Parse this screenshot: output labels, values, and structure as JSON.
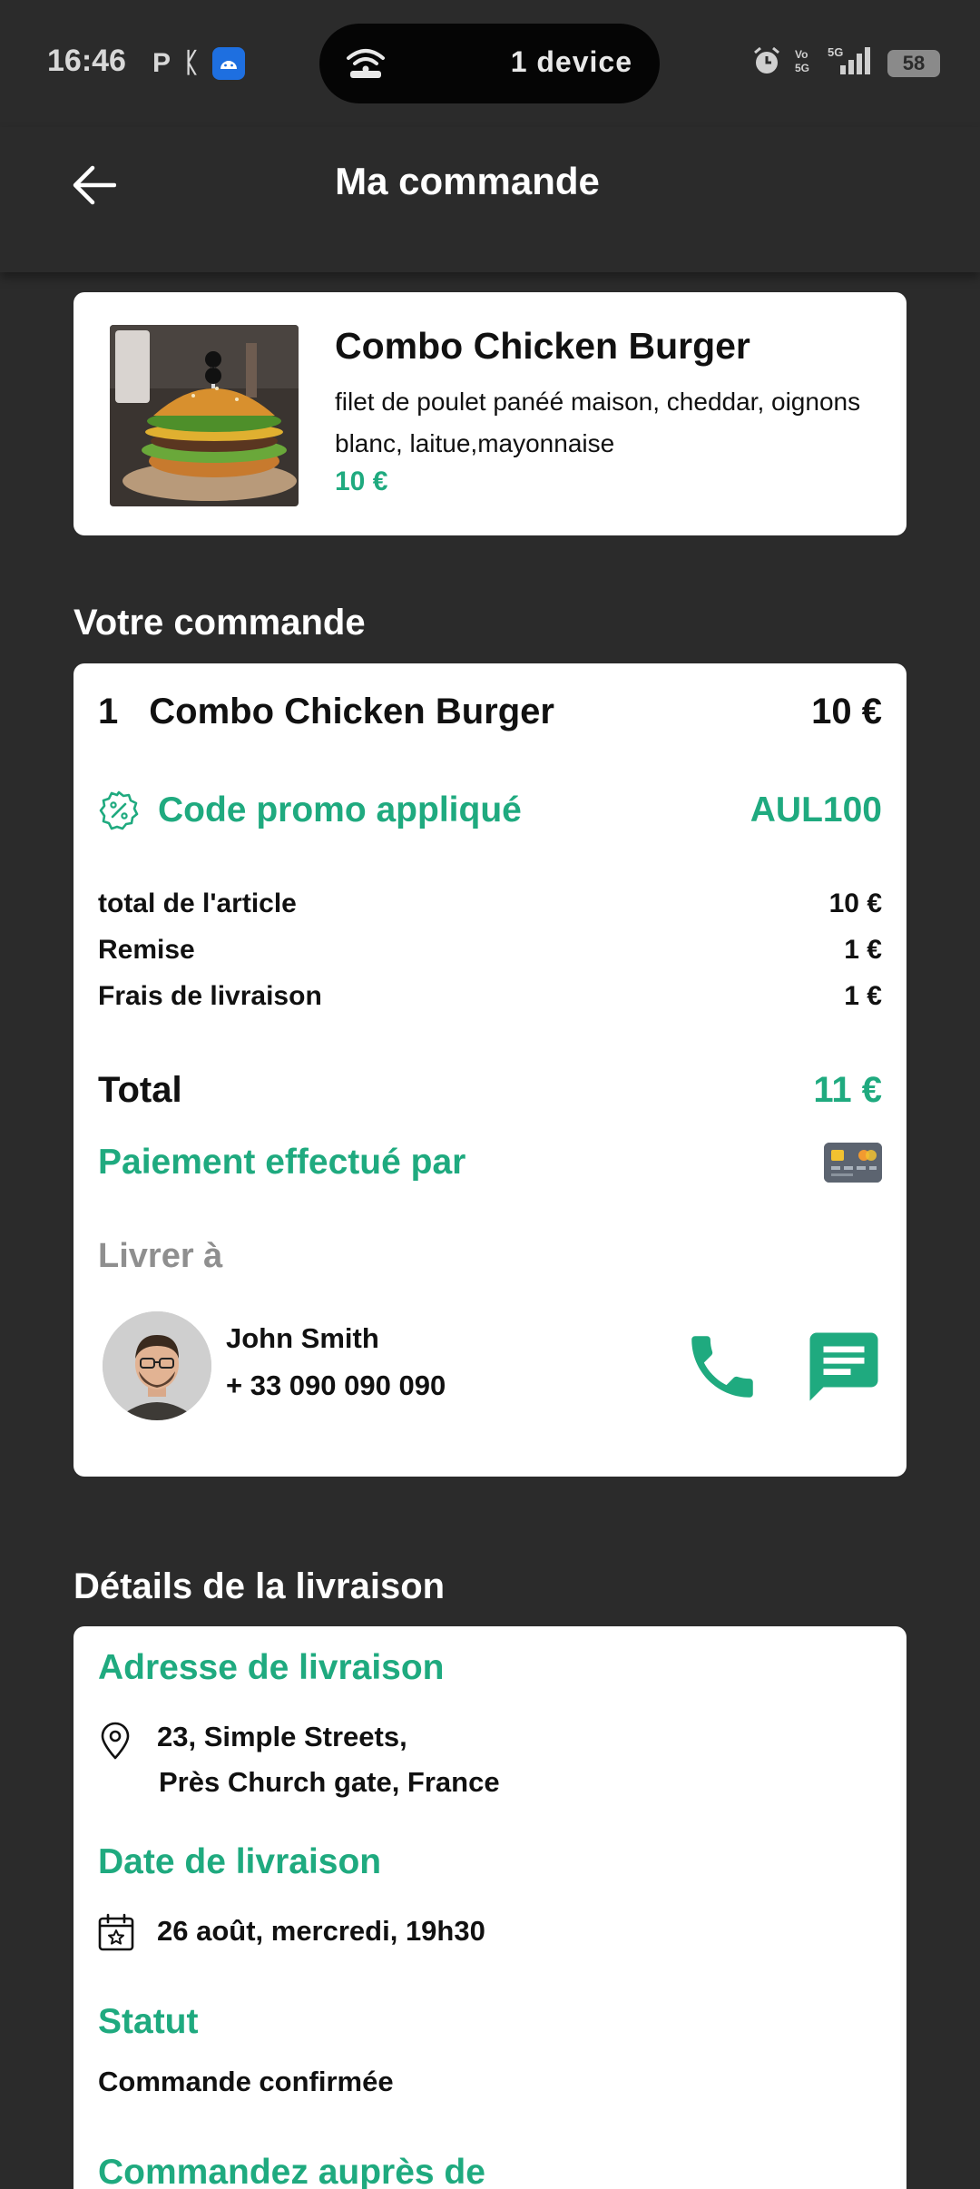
{
  "status_bar": {
    "time": "16:46",
    "pill_text": "1 device",
    "network": "5G",
    "battery": "58"
  },
  "header": {
    "title": "Ma commande"
  },
  "product": {
    "name": "Combo Chicken Burger",
    "description": "filet de poulet panéé maison, cheddar, oignons blanc, laitue,mayonnaise",
    "price": "10 €"
  },
  "order_section": {
    "title": "Votre commande",
    "item": {
      "qty": "1",
      "name": "Combo Chicken Burger",
      "price": "10 €"
    },
    "promo": {
      "label": "Code promo appliqué",
      "code": "AUL100"
    },
    "lines": [
      {
        "label": "total de l'article",
        "value": "10 €"
      },
      {
        "label": "Remise",
        "value": "1 €"
      },
      {
        "label": "Frais de livraison",
        "value": "1 €"
      }
    ],
    "total": {
      "label": "Total",
      "value": "11 €"
    },
    "payment_label": "Paiement effectué par",
    "deliver_to_label": "Livrer à",
    "customer": {
      "name": "John Smith",
      "phone": "+ 33 090 090 090"
    }
  },
  "delivery_section": {
    "title": "Détails de la livraison",
    "address_label": "Adresse de livraison",
    "address_line1": "23, Simple Streets,",
    "address_line2": "Près Church gate, France",
    "date_label": "Date de livraison",
    "date_value": "26 août, mercredi, 19h30",
    "status_label": "Statut",
    "status_value": "Commande confirmée",
    "order_from_label": "Commandez auprès de"
  },
  "colors": {
    "accent": "#1faa7f",
    "background": "#2b2b2b",
    "card": "#ffffff",
    "muted": "#8f8f8f"
  }
}
